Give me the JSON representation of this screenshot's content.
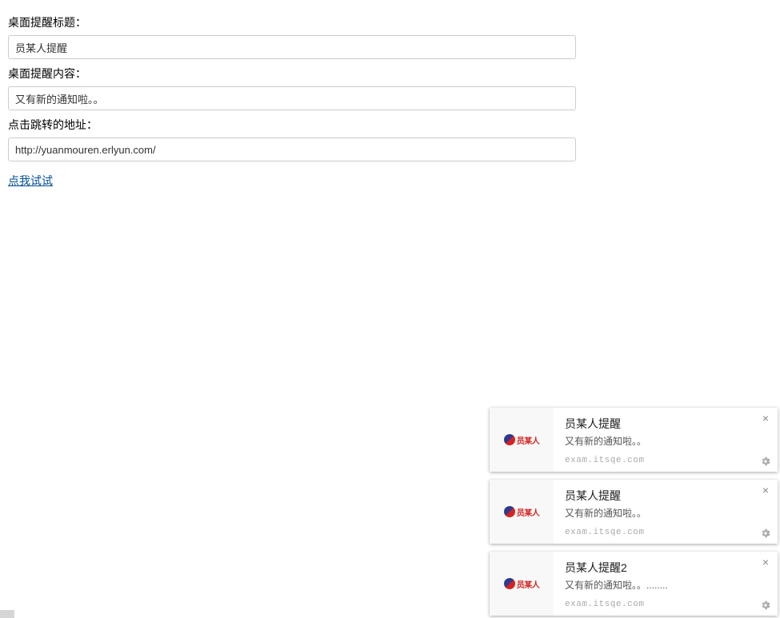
{
  "form": {
    "title_label": "桌面提醒标题：",
    "title_value": "员某人提醒",
    "content_label": "桌面提醒内容：",
    "content_value": "又有新的通知啦。。",
    "url_label": "点击跳转的地址：",
    "url_value": "http://yuanmouren.erlyun.com/",
    "try_link": "点我试试"
  },
  "notif_icon_text": "员某人",
  "notifications": [
    {
      "title": "员某人提醒",
      "content": "又有新的通知啦。。",
      "origin": "exam.itsqe.com"
    },
    {
      "title": "员某人提醒",
      "content": "又有新的通知啦。。",
      "origin": "exam.itsqe.com"
    },
    {
      "title": "员某人提醒2",
      "content": "又有新的通知啦。。........",
      "origin": "exam.itsqe.com"
    }
  ]
}
